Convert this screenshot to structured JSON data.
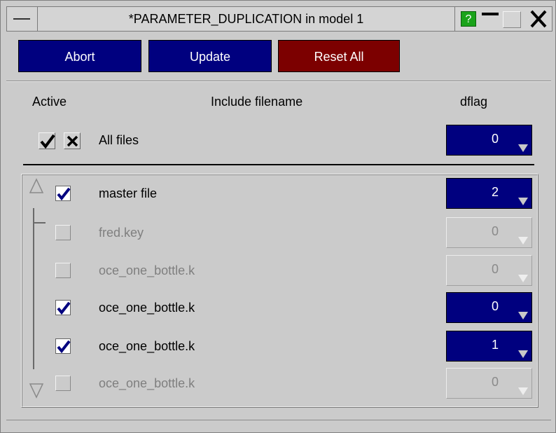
{
  "window": {
    "title": "*PARAMETER_DUPLICATION in model 1",
    "help_label": "?",
    "close_label": "✕"
  },
  "toolbar": {
    "abort_label": "Abort",
    "update_label": "Update",
    "reset_label": "Reset All"
  },
  "headers": {
    "active": "Active",
    "filename": "Include filename",
    "dflag": "dflag"
  },
  "all_files": {
    "label": "All files",
    "dflag": "0"
  },
  "rows": [
    {
      "name": "master file",
      "active": true,
      "enabled": true,
      "dflag": "2"
    },
    {
      "name": "fred.key",
      "active": false,
      "enabled": false,
      "dflag": "0"
    },
    {
      "name": "oce_one_bottle.k",
      "active": false,
      "enabled": false,
      "dflag": "0"
    },
    {
      "name": "oce_one_bottle.k",
      "active": true,
      "enabled": true,
      "dflag": "0"
    },
    {
      "name": "oce_one_bottle.k",
      "active": true,
      "enabled": true,
      "dflag": "1"
    },
    {
      "name": "oce_one_bottle.k",
      "active": false,
      "enabled": false,
      "dflag": "0"
    }
  ],
  "colors": {
    "button_blue": "#00007f",
    "button_red": "#7c0000",
    "help_green": "#1aa31a",
    "background": "#cbcbcb"
  }
}
